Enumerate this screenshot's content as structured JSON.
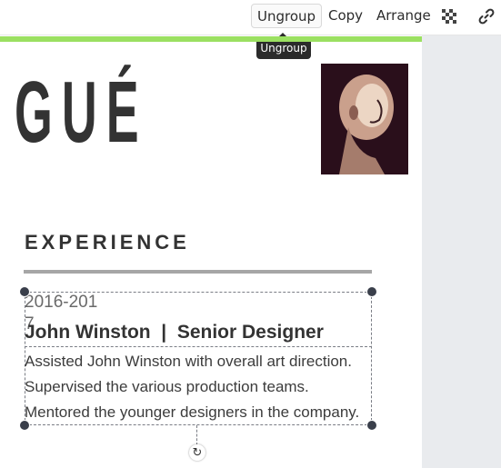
{
  "toolbar": {
    "ungroup_label": "Ungroup",
    "copy_label": "Copy",
    "arrange_label": "Arrange",
    "transparency_icon": "checkerboard-icon",
    "link_icon": "link-icon"
  },
  "tooltip": {
    "text": "Ungroup"
  },
  "resume": {
    "name_fragment": "GUÉ",
    "photo_alt": "profile-photo",
    "section_title": "EXPERIENCE",
    "experience": {
      "date": "2016-2017",
      "title": "John Winston  |  Senior Designer",
      "lines": [
        "Assisted John Winston with overall art direction.",
        "Supervised the various production teams.",
        "Mentored the younger designers in the company."
      ]
    }
  },
  "colors": {
    "accent": "#9be061",
    "text_dark": "#333333",
    "selection": "#3a3f4b"
  }
}
